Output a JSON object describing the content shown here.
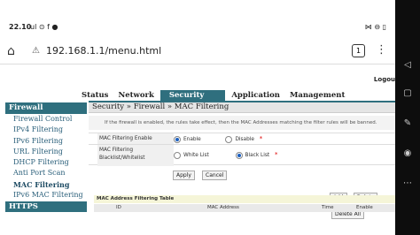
{
  "statusbar": {
    "time": "22.10",
    "left_icons": "ul ⊙ f ●",
    "right_icons": "⋈ ⊖ ▯"
  },
  "browser": {
    "url": "192.168.1.1/menu.html",
    "tab_count": "1"
  },
  "logout": "Logou",
  "topnav": [
    "Status",
    "Network",
    "Security",
    "Application",
    "Management"
  ],
  "sidebar": {
    "header": "Firewall",
    "items": [
      "Firewall Control",
      "IPv4 Filtering",
      "IPv6 Filtering",
      "URL Filtering",
      "DHCP Filtering",
      "Anti Port Scan",
      "MAC Filtering",
      "IPv6 MAC Filtering"
    ],
    "header2": "HTTPS"
  },
  "breadcrumb": "Security » Firewall » MAC Filtering",
  "note": "If the firewall is enabled, the rules take effect, then the MAC Addresses matching the filter rules will be banned.",
  "form": {
    "enable_label": "MAC Filtering Enable",
    "enable_option": "Enable",
    "disable_option": "Disable",
    "mode_label_1": "MAC Filtering",
    "mode_label_2": "Blacklist/Whitelist",
    "white_option": "White List",
    "black_option": "Black List",
    "required_mark": "*",
    "apply": "Apply",
    "cancel": "Cancel"
  },
  "table_buttons": {
    "add": "Add",
    "delete": "Delete",
    "delete_all": "Delete All"
  },
  "table": {
    "title": "MAC Address Filtering Table",
    "columns": [
      "ID",
      "MAC Address",
      "Time",
      "Enable"
    ]
  }
}
